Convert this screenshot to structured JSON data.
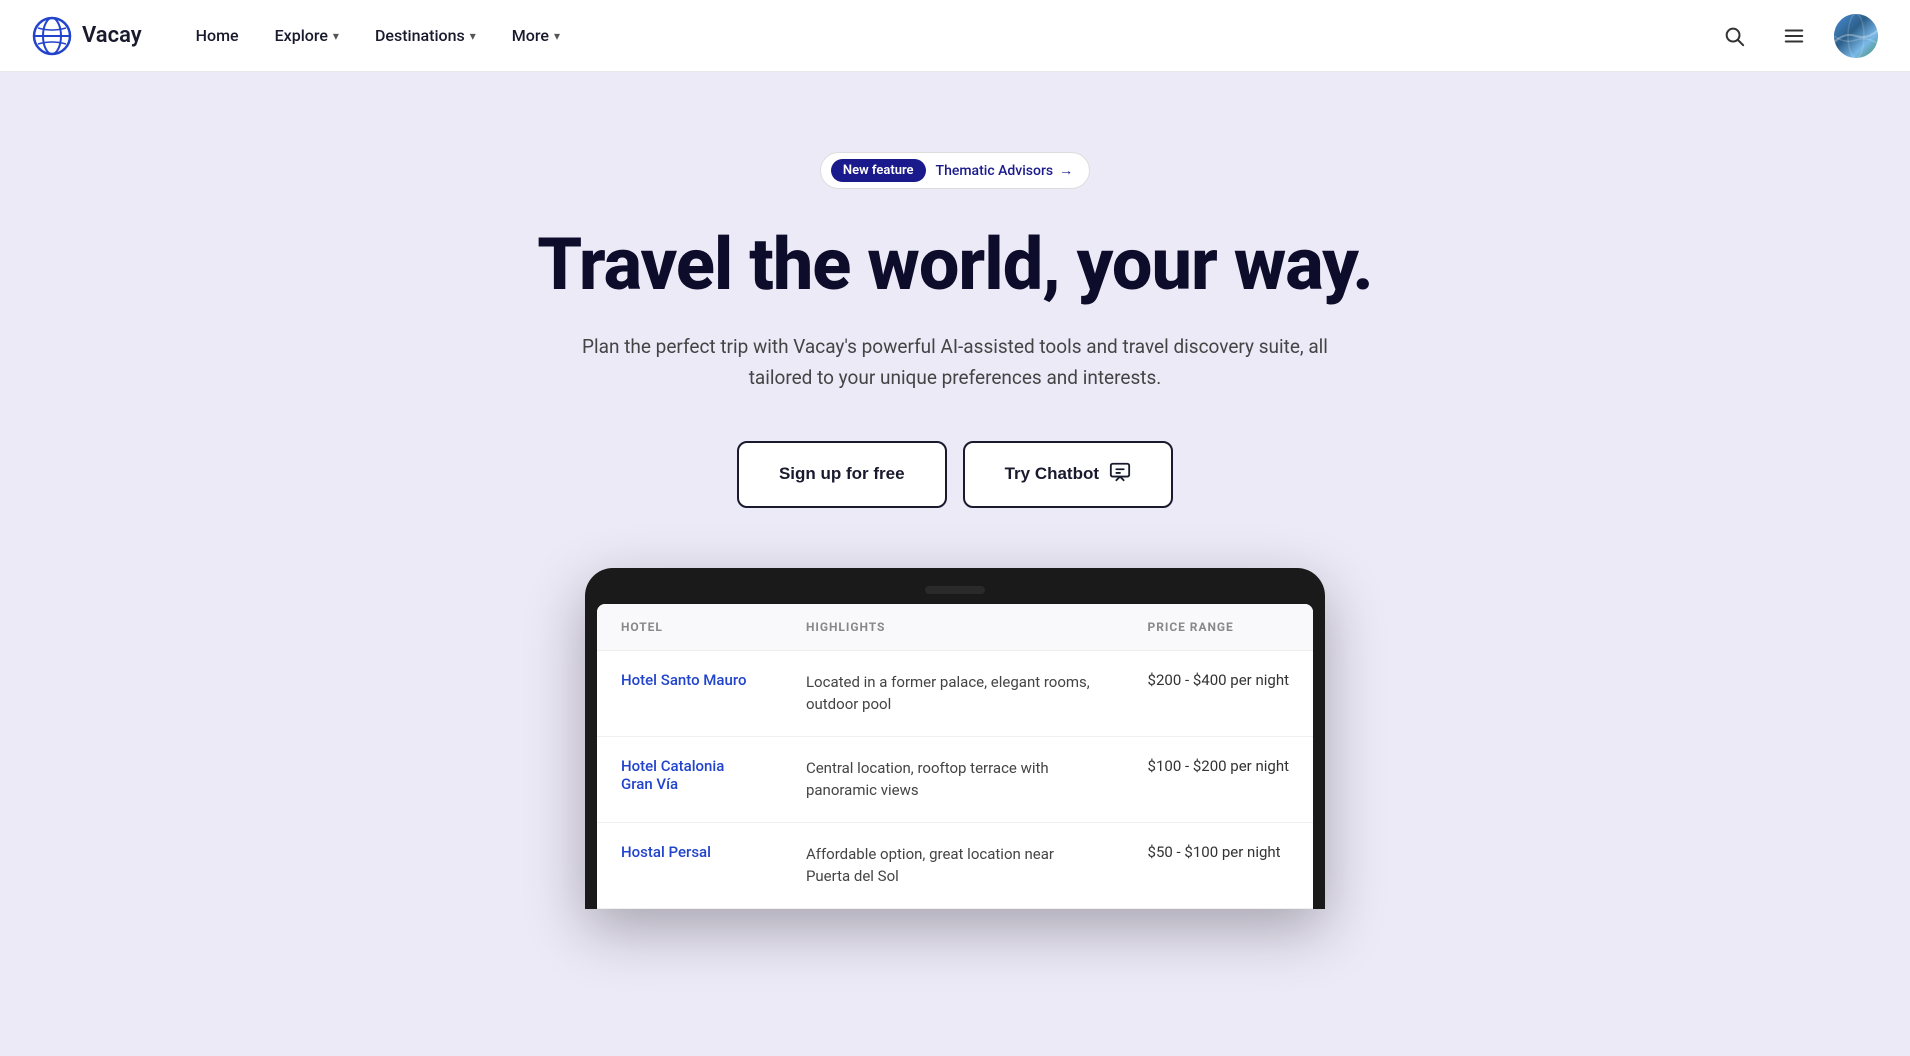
{
  "navbar": {
    "logo_text": "Vacay",
    "links": [
      {
        "label": "Home",
        "has_dropdown": false
      },
      {
        "label": "Explore",
        "has_dropdown": true
      },
      {
        "label": "Destinations",
        "has_dropdown": true
      },
      {
        "label": "More",
        "has_dropdown": true
      }
    ]
  },
  "hero": {
    "badge": {
      "label": "New feature",
      "link_text": "Thematic Advisors",
      "arrow": "→"
    },
    "title": "Travel the world, your way.",
    "subtitle": "Plan the perfect trip with Vacay's powerful AI-assisted tools and travel discovery suite, all tailored to your unique preferences and interests.",
    "btn_signup": "Sign up for free",
    "btn_chatbot": "Try Chatbot",
    "chatbot_icon": "💬"
  },
  "hotel_table": {
    "columns": [
      "HOTEL",
      "HIGHLIGHTS",
      "PRICE RANGE"
    ],
    "rows": [
      {
        "name": "Hotel Santo Mauro",
        "highlights": "Located in a former palace, elegant rooms, outdoor pool",
        "price": "$200 - $400 per night"
      },
      {
        "name": "Hotel Catalonia Gran Vía",
        "highlights": "Central location, rooftop terrace with panoramic views",
        "price": "$100 - $200 per night"
      },
      {
        "name": "Hostal Persal",
        "highlights": "Affordable option, great location near Puerta del Sol",
        "price": "$50 - $100 per night"
      }
    ]
  }
}
